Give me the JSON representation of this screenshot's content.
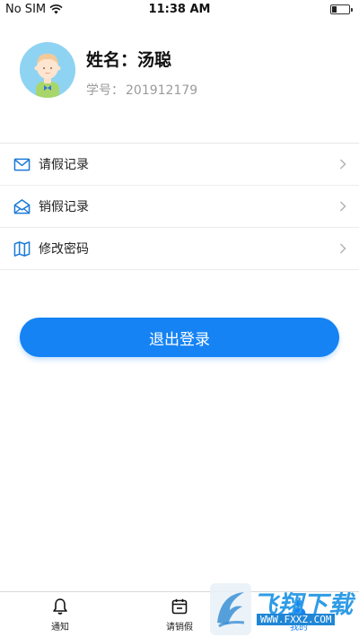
{
  "status_bar": {
    "carrier": "No SIM",
    "time": "11:38 AM",
    "icons": [
      "wifi-icon",
      "battery-icon"
    ]
  },
  "profile": {
    "name": "姓名：汤聪",
    "student_id_label": "学号：",
    "student_id_value": "201912179",
    "avatar_icon": "avatar-boy"
  },
  "menu": {
    "items": [
      {
        "label": "请假记录",
        "icon": "mail-icon"
      },
      {
        "label": "销假记录",
        "icon": "envelope-open-icon"
      },
      {
        "label": "修改密码",
        "icon": "map-icon"
      }
    ]
  },
  "logout_label": "退出登录",
  "tabbar": {
    "tabs": [
      {
        "label": "通知",
        "icon": "bell-icon",
        "active": false
      },
      {
        "label": "请销假",
        "icon": "calendar-icon",
        "active": false
      },
      {
        "label": "我的",
        "icon": "person-icon",
        "active": true
      }
    ]
  },
  "watermark": {
    "text": "飞翔下载",
    "url": "WWW.FXXZ.COM"
  },
  "colors": {
    "accent": "#1583f4",
    "muted_text": "#9b9b9b",
    "divider": "#ececec"
  }
}
